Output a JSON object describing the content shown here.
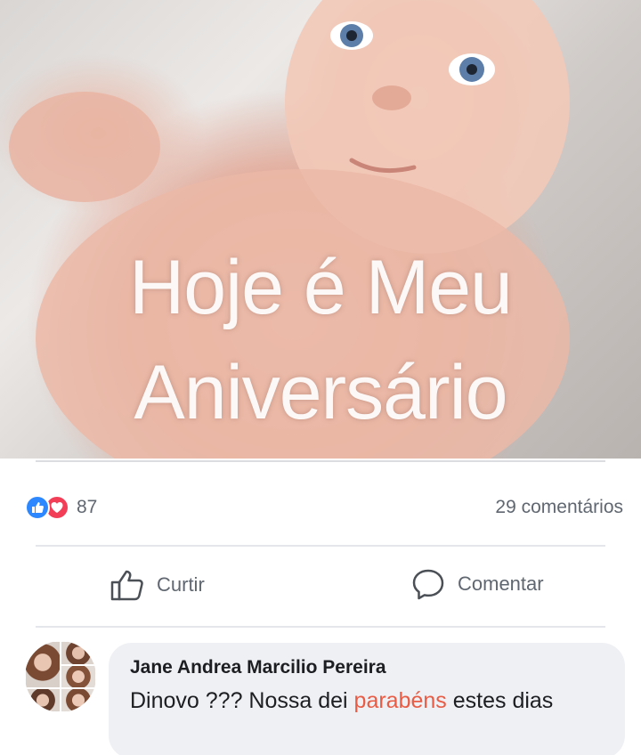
{
  "post": {
    "overlay_line1": "Hoje é Meu",
    "overlay_line2": "Aniversário"
  },
  "stats": {
    "reaction_count": "87",
    "comments_label": "29 comentários",
    "reaction_types": [
      "like",
      "love"
    ]
  },
  "actions": {
    "like_label": "Curtir",
    "comment_label": "Comentar"
  },
  "comment": {
    "author": "Jane Andrea Marcilio Pereira",
    "text_before": "Dinovo ??? Nossa dei ",
    "text_highlight": "parabéns",
    "text_after": " estes dias"
  },
  "colors": {
    "like_blue": "#2d88ff",
    "love_red": "#f33e58",
    "secondary_text": "#606770",
    "bubble_bg": "#eff0f3",
    "highlight": "#e85c46"
  },
  "icons": {
    "like_reaction": "thumbs-up-icon",
    "love_reaction": "heart-icon",
    "like_action": "thumbs-up-outline-icon",
    "comment_action": "speech-bubble-icon"
  }
}
